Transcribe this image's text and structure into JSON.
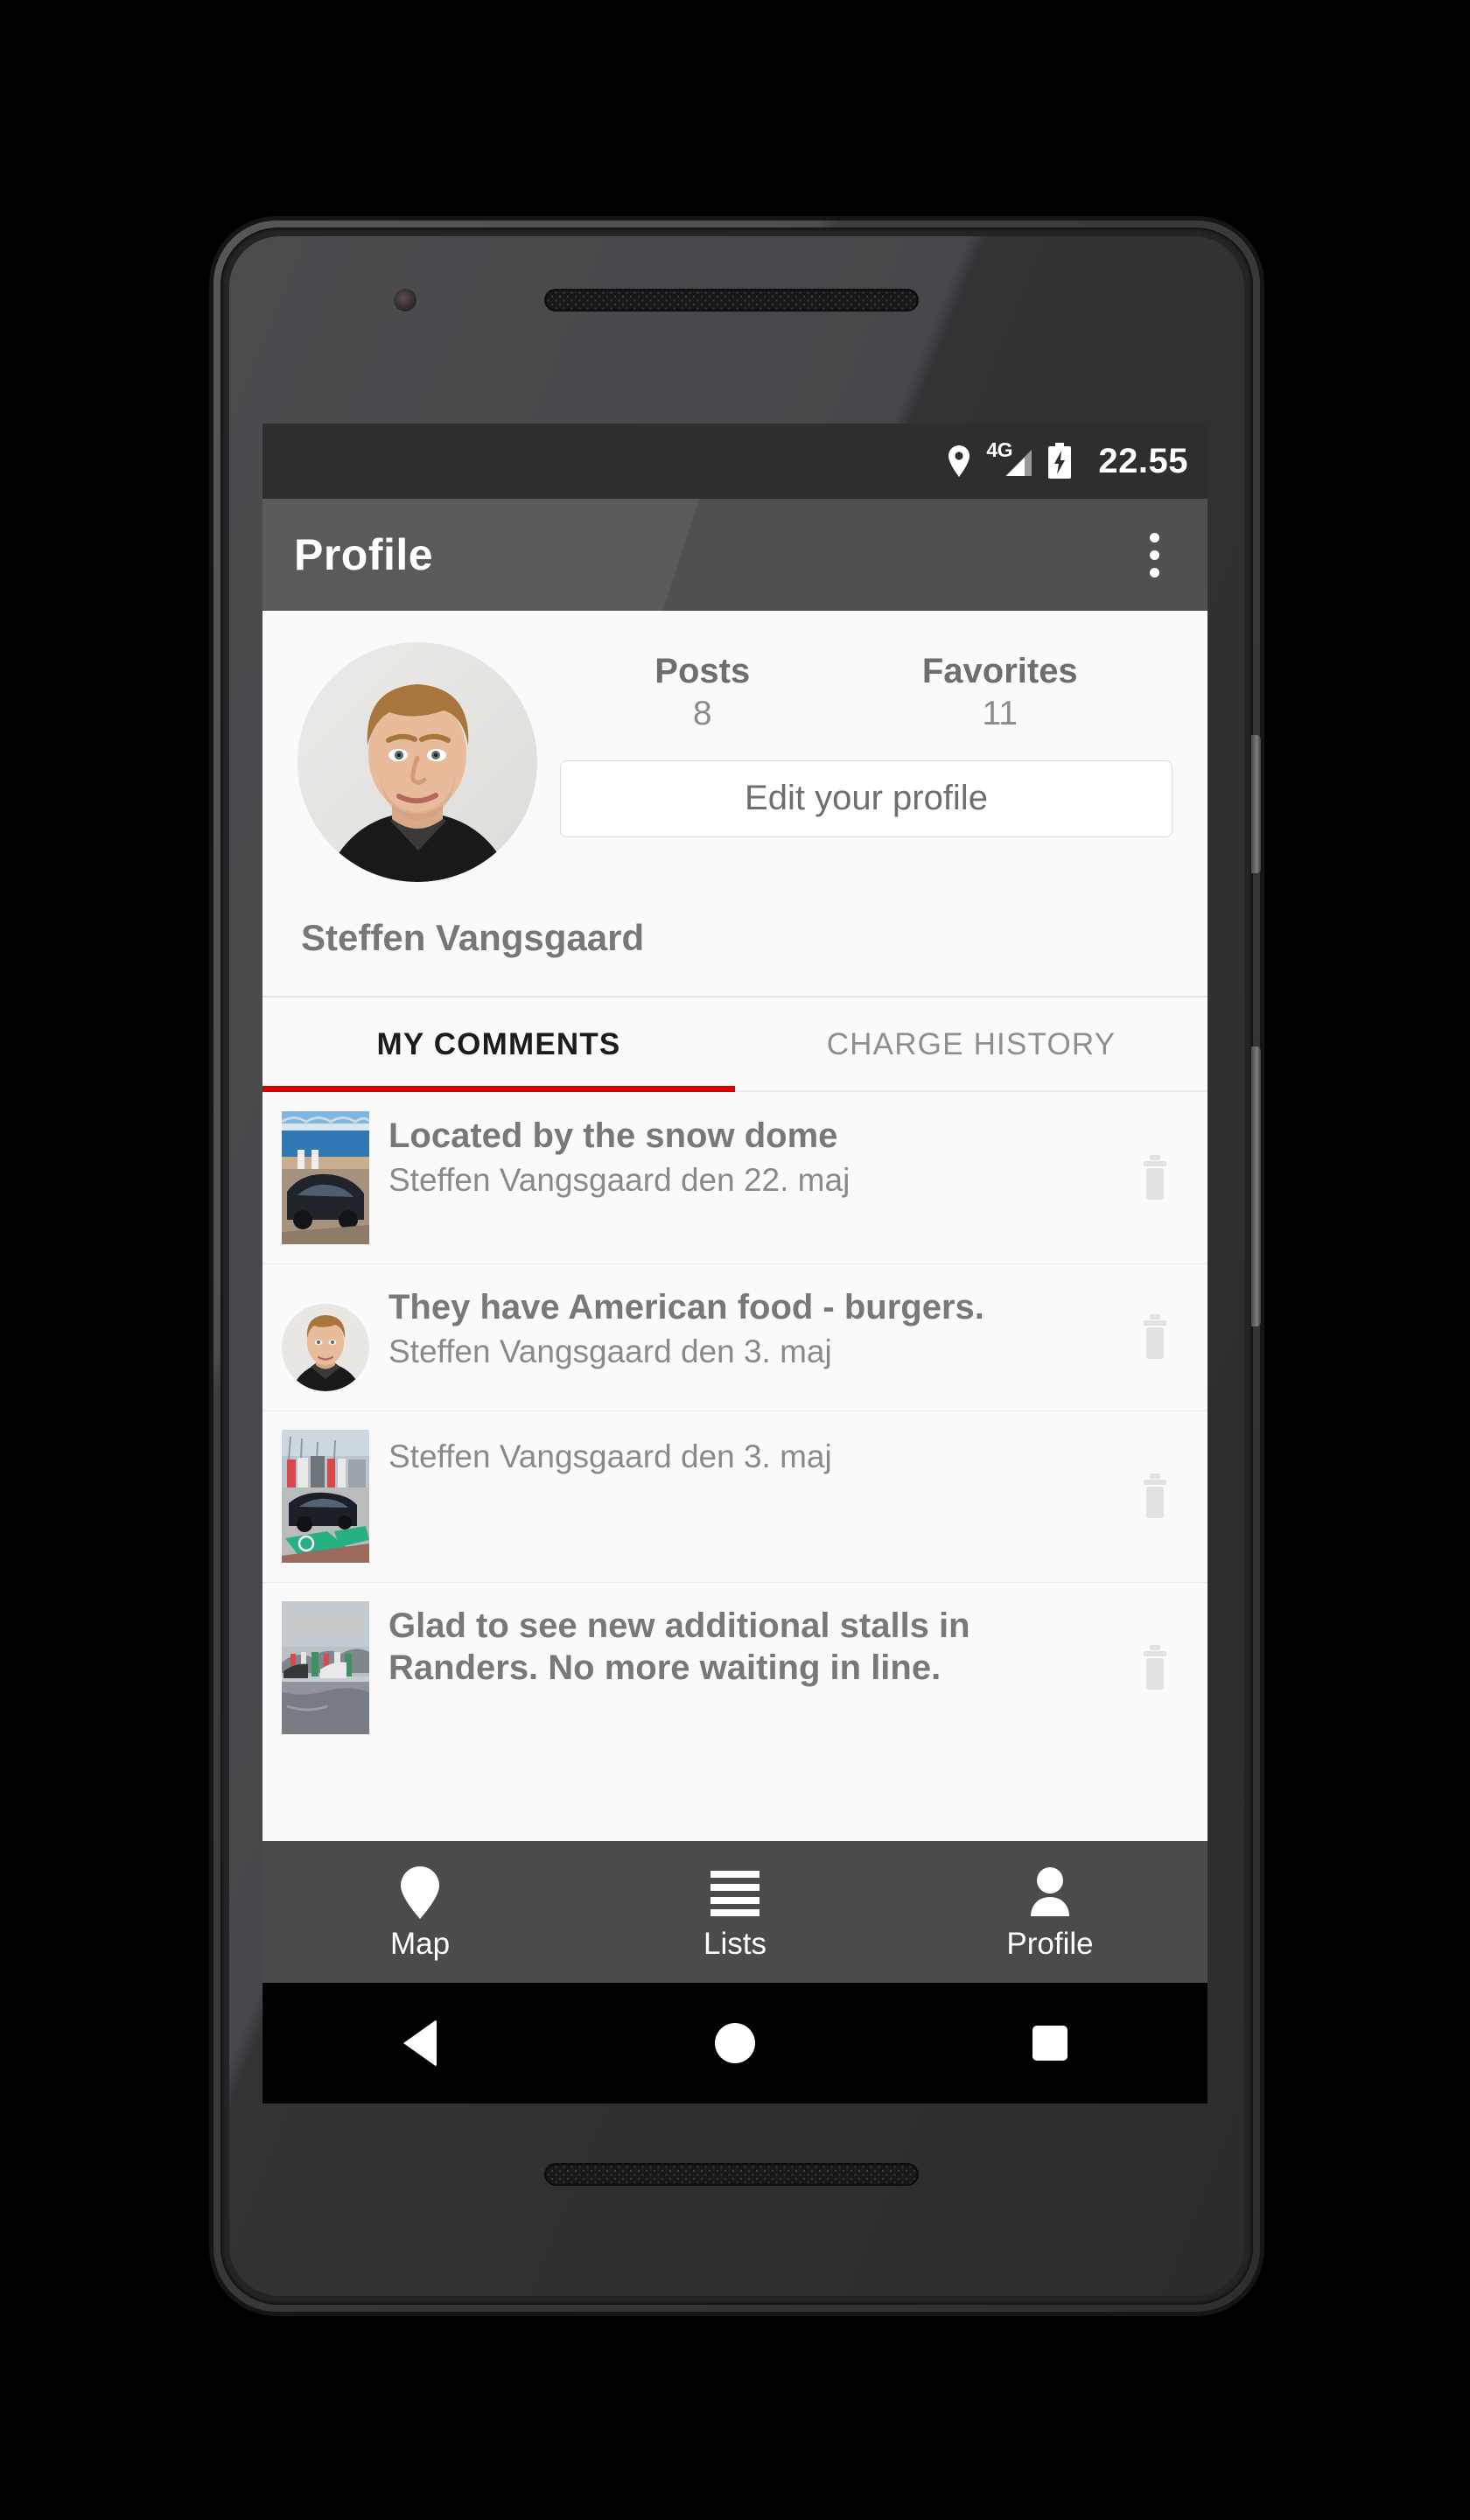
{
  "statusbar": {
    "location_icon": "location-pin-icon",
    "network_label": "4G",
    "signal_icon": "signal-bars-icon",
    "battery_icon": "battery-charging-icon",
    "time": "22.55"
  },
  "appbar": {
    "title": "Profile",
    "overflow_icon": "overflow-menu-icon"
  },
  "profile": {
    "avatar": "user-avatar-photo",
    "name": "Steffen Vangsgaard",
    "stats": [
      {
        "label": "Posts",
        "value": "8"
      },
      {
        "label": "Favorites",
        "value": "11"
      }
    ],
    "edit_button": "Edit your profile"
  },
  "tabs": [
    {
      "label": "MY COMMENTS",
      "active": true
    },
    {
      "label": "CHARGE HISTORY",
      "active": false
    }
  ],
  "comments": [
    {
      "title": "Located by the snow dome",
      "meta": "Steffen Vangsgaard  den 22. maj",
      "thumb": "photo-tesla-at-charger",
      "thumb_shape": "square",
      "delete_icon": "trash-icon"
    },
    {
      "title": "They have American food -  burgers.",
      "meta": "Steffen Vangsgaard  den 3. maj",
      "thumb": "photo-user-portrait",
      "thumb_shape": "round",
      "delete_icon": "trash-icon"
    },
    {
      "title": "",
      "meta": "Steffen Vangsgaard  den 3. maj",
      "thumb": "photo-supercharger-stalls",
      "thumb_shape": "square",
      "delete_icon": "trash-icon"
    },
    {
      "title": "Glad to see new additional stalls in Randers. No more waiting in line.",
      "meta": "",
      "thumb": "photo-rainy-charger-lot",
      "thumb_shape": "square",
      "delete_icon": "trash-icon"
    }
  ],
  "bottomnav": [
    {
      "label": "Map",
      "icon": "map-pin-icon"
    },
    {
      "label": "Lists",
      "icon": "list-lines-icon"
    },
    {
      "label": "Profile",
      "icon": "person-icon"
    }
  ],
  "sysnav": [
    {
      "icon": "back-triangle-icon"
    },
    {
      "icon": "home-circle-icon"
    },
    {
      "icon": "recents-square-icon"
    }
  ],
  "colors": {
    "accent": "#d50000",
    "appbar": "#5a5a5a",
    "statusbar": "#2e2e2e",
    "bottomnav": "#4b4b4b"
  }
}
